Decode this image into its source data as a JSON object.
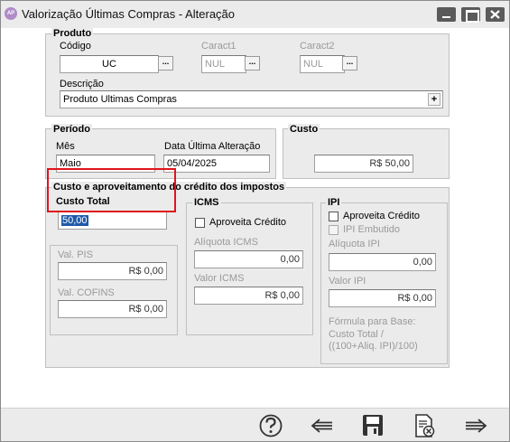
{
  "window": {
    "title": "Valorização Últimas Compras - Alteração",
    "app_icon_text": "AP"
  },
  "produto": {
    "section_title": "Produto",
    "codigo_label": "Código",
    "codigo_value": "UC",
    "caract1_label": "Caract1",
    "caract1_value": "NUL",
    "caract2_label": "Caract2",
    "caract2_value": "NUL",
    "descricao_label": "Descrição",
    "descricao_value": "Produto Ultimas Compras",
    "ellipsis": "...",
    "plus": "+"
  },
  "periodo": {
    "section_title": "Período",
    "mes_label": "Mês",
    "mes_value": "Maio",
    "data_label": "Data Última Alteração",
    "data_value": "05/04/2025"
  },
  "custo": {
    "section_title": "Custo",
    "value": "R$ 50,00"
  },
  "impostos": {
    "section_title": "Custo e aproveitamento do crédito dos impostos",
    "custo_total_label": "Custo Total",
    "custo_total_value": "50,00",
    "val_pis_label": "Val. PIS",
    "val_pis_value": "R$ 0,00",
    "val_cofins_label": "Val. COFINS",
    "val_cofins_value": "R$ 0,00",
    "icms": {
      "title": "ICMS",
      "aproveita_label": "Aproveita Crédito",
      "aliquota_label": "Alíquota ICMS",
      "aliquota_value": "0,00",
      "valor_label": "Valor ICMS",
      "valor_value": "R$ 0,00"
    },
    "ipi": {
      "title": "IPI",
      "aproveita_label": "Aproveita Crédito",
      "embutido_label": "IPI Embutido",
      "aliquota_label": "Alíquota IPI",
      "aliquota_value": "0,00",
      "valor_label": "Valor IPI",
      "valor_value": "R$ 0,00",
      "formula_line1": "Fórmula para Base:",
      "formula_line2": "Custo Total /",
      "formula_line3": "((100+Aliq. IPI)/100)"
    }
  },
  "toolbar": {
    "icons": [
      "help-icon",
      "back-arrow-icon",
      "save-icon",
      "cancel-document-icon",
      "forward-arrow-icon"
    ]
  }
}
